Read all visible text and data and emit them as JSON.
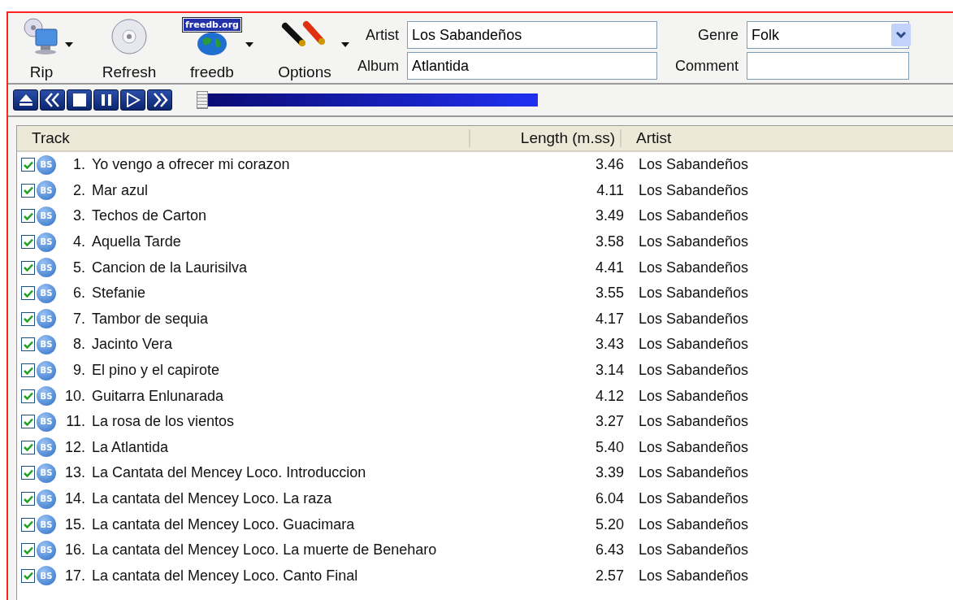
{
  "toolbar": {
    "buttons": [
      {
        "label": "Rip",
        "kind": "rip",
        "dropdown": true
      },
      {
        "label": "Refresh",
        "kind": "refresh",
        "dropdown": false
      },
      {
        "label": "freedb",
        "kind": "freedb",
        "logo_text": "freedb.org",
        "dropdown": true
      },
      {
        "label": "Options",
        "kind": "options",
        "dropdown": true
      }
    ]
  },
  "fields": [
    {
      "label": "Artist",
      "value": "Los Sabandeños"
    },
    {
      "label": "Album",
      "value": "Atlantida"
    }
  ],
  "fields_right": [
    {
      "label": "Genre",
      "value": "Folk",
      "kind": "select"
    },
    {
      "label": "Comment",
      "kind": "text"
    }
  ],
  "transport": {
    "buttons": [
      {
        "kind": "eject"
      },
      {
        "kind": "previous"
      },
      {
        "kind": "stop"
      },
      {
        "kind": "pause"
      },
      {
        "kind": "play"
      },
      {
        "kind": "next"
      }
    ],
    "position": {
      "level": 0
    }
  },
  "table": {
    "columns": [
      "Track",
      "Length (m.ss)",
      "Artist"
    ],
    "rows": [
      {
        "checked": true,
        "icon_text": "BS",
        "number": "1.",
        "title": "Yo vengo a ofrecer mi corazon",
        "length": "3.46",
        "artist": "Los Sabandeños"
      },
      {
        "checked": true,
        "icon_text": "BS",
        "number": "2.",
        "title": "Mar azul",
        "length": "4.11",
        "artist": "Los Sabandeños"
      },
      {
        "checked": true,
        "icon_text": "BS",
        "number": "3.",
        "title": "Techos de Carton",
        "length": "3.49",
        "artist": "Los Sabandeños"
      },
      {
        "checked": true,
        "icon_text": "BS",
        "number": "4.",
        "title": "Aquella Tarde",
        "length": "3.58",
        "artist": "Los Sabandeños"
      },
      {
        "checked": true,
        "icon_text": "BS",
        "number": "5.",
        "title": "Cancion de la Laurisilva",
        "length": "4.41",
        "artist": "Los Sabandeños"
      },
      {
        "checked": true,
        "icon_text": "BS",
        "number": "6.",
        "title": "Stefanie",
        "length": "3.55",
        "artist": "Los Sabandeños"
      },
      {
        "checked": true,
        "icon_text": "BS",
        "number": "7.",
        "title": "Tambor de sequia",
        "length": "4.17",
        "artist": "Los Sabandeños"
      },
      {
        "checked": true,
        "icon_text": "BS",
        "number": "8.",
        "title": "Jacinto Vera",
        "length": "3.43",
        "artist": "Los Sabandeños"
      },
      {
        "checked": true,
        "icon_text": "BS",
        "number": "9.",
        "title": "El pino y el capirote",
        "length": "3.14",
        "artist": "Los Sabandeños"
      },
      {
        "checked": true,
        "icon_text": "BS",
        "number": "10.",
        "title": "Guitarra Enlunarada",
        "length": "4.12",
        "artist": "Los Sabandeños"
      },
      {
        "checked": true,
        "icon_text": "BS",
        "number": "11.",
        "title": "La rosa de los vientos",
        "length": "3.27",
        "artist": "Los Sabandeños"
      },
      {
        "checked": true,
        "icon_text": "BS",
        "number": "12.",
        "title": "La Atlantida",
        "length": "5.40",
        "artist": "Los Sabandeños"
      },
      {
        "checked": true,
        "icon_text": "BS",
        "number": "13.",
        "title": "La Cantata del Mencey Loco. Introduccion",
        "length": "3.39",
        "artist": "Los Sabandeños"
      },
      {
        "checked": true,
        "icon_text": "BS",
        "number": "14.",
        "title": "La cantata del Mencey Loco. La raza",
        "length": "6.04",
        "artist": "Los Sabandeños"
      },
      {
        "checked": true,
        "icon_text": "BS",
        "number": "15.",
        "title": "La cantata del Mencey Loco. Guacimara",
        "length": "5.20",
        "artist": "Los Sabandeños"
      },
      {
        "checked": true,
        "icon_text": "BS",
        "number": "16.",
        "title": "La cantata del Mencey Loco. La muerte de Beneharo",
        "length": "6.43",
        "artist": "Los Sabandeños"
      },
      {
        "checked": true,
        "icon_text": "BS",
        "number": "17.",
        "title": "La cantata del Mencey Loco. Canto Final",
        "length": "2.57",
        "artist": "Los Sabandeños"
      }
    ]
  }
}
